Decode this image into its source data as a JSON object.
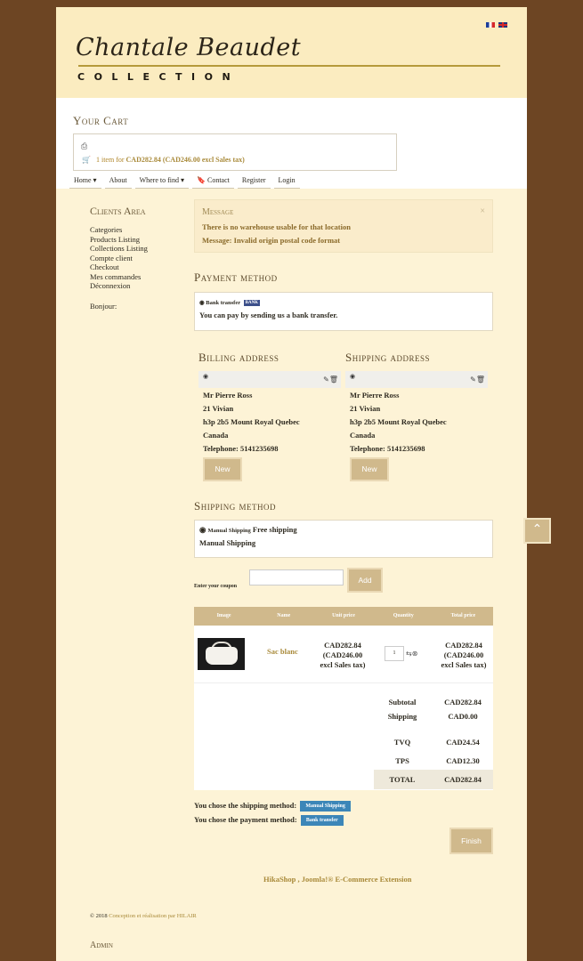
{
  "header": {
    "logo_script": "Chantale Beaudet",
    "logo_sub": "COLLECTION",
    "flags": [
      "fr-flag-icon",
      "en-flag-icon"
    ]
  },
  "cart": {
    "title": "Your Cart",
    "print_icon": "⎙",
    "cart_icon": "🛒",
    "summary_prefix": "1 item for",
    "summary_amount": "CAD282.84 (CAD246.00 excl Sales tax)"
  },
  "menu": {
    "items": [
      "Home ▾",
      "About",
      "Where to find ▾",
      "🔖 Contact",
      "Register",
      "Login"
    ]
  },
  "sidebar": {
    "title": "Clients Area",
    "links": [
      "Categories",
      "Products Listing",
      "Collections Listing",
      "Compte client",
      "Checkout",
      "Mes commandes",
      "Déconnexion"
    ],
    "greeting": "Bonjour:"
  },
  "message": {
    "title": "Message",
    "close": "×",
    "line1": "There is no warehouse usable for that location",
    "line2": "Message: Invalid origin postal code format"
  },
  "payment": {
    "title": "Payment method",
    "option_label": "Bank transfer",
    "option_tag": "BANK",
    "description": "You can pay by sending us a bank transfer."
  },
  "billing": {
    "title": "Billing address",
    "name": "Mr Pierre Ross",
    "street": "21 Vivian",
    "city": "h3p 2b5 Mount Royal Quebec",
    "country": "Canada",
    "phone": "Telephone: 5141235698",
    "new_label": "New"
  },
  "shipping_address": {
    "title": "Shipping address",
    "name": "Mr Pierre Ross",
    "street": "21 Vivian",
    "city": "h3p 2b5 Mount Royal Quebec",
    "country": "Canada",
    "phone": "Telephone: 5141235698",
    "new_label": "New"
  },
  "shipping_method": {
    "title": "Shipping method",
    "option_small": "Manual Shipping",
    "option_price": "Free shipping",
    "description": "Manual Shipping"
  },
  "coupon": {
    "label": "Enter your coupon",
    "value": "",
    "add_label": "Add"
  },
  "table": {
    "headers": [
      "Image",
      "Name",
      "Unit price",
      "Quantity",
      "Total price"
    ],
    "row": {
      "name": "Sac blanc",
      "unit_price": "CAD282.84",
      "unit_price_excl": "(CAD246.00",
      "unit_price_excl2": "excl Sales tax)",
      "quantity": "1",
      "total_price": "CAD282.84",
      "total_price_excl": "(CAD246.00",
      "total_price_excl2": "excl Sales tax)"
    }
  },
  "summary": {
    "subtotal_label": "Subtotal",
    "subtotal": "CAD282.84",
    "shipping_label": "Shipping",
    "shipping": "CAD0.00",
    "tvq_label": "TVQ",
    "tvq": "CAD24.54",
    "tps_label": "TPS",
    "tps": "CAD12.30",
    "total_label": "TOTAL",
    "total": "CAD282.84"
  },
  "chosen": {
    "shipping_text": "You chose the shipping method:",
    "shipping_tag": "Manual Shipping",
    "payment_text": "You chose the payment method:",
    "payment_tag": "Bank transfer"
  },
  "finish_label": "Finish",
  "footer": {
    "hikashop": "HikaShop , Joomla!® E-Commerce Extension",
    "copyright_prefix": "© 2018",
    "copyright_link": "Conception et réalisation par HILAIR",
    "admin": "Admin"
  },
  "colors": {
    "background": "#6d4523",
    "accent": "#d0b98c",
    "tag_blue": "#3c86b8"
  }
}
